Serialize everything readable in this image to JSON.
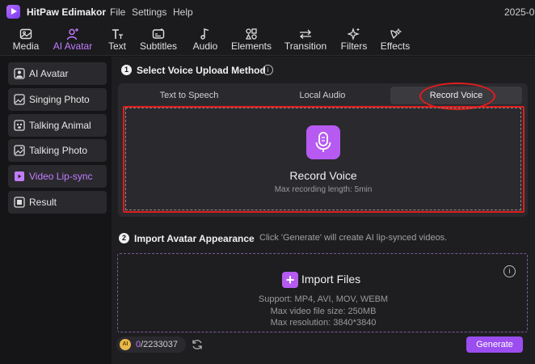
{
  "titlebar": {
    "app_title": "HitPaw Edimakor",
    "menus": [
      "File",
      "Settings",
      "Help"
    ],
    "date_fragment": "2025-0"
  },
  "toolbar": {
    "tools": [
      {
        "label": "Media",
        "icon": "image-icon"
      },
      {
        "label": "AI Avatar",
        "icon": "person-sparkle-icon",
        "active": true
      },
      {
        "label": "Text",
        "icon": "text-icon"
      },
      {
        "label": "Subtitles",
        "icon": "subtitles-icon"
      },
      {
        "label": "Audio",
        "icon": "music-note-icon"
      },
      {
        "label": "Elements",
        "icon": "shapes-icon"
      },
      {
        "label": "Transition",
        "icon": "arrows-icon"
      },
      {
        "label": "Filters",
        "icon": "sparkles-icon"
      },
      {
        "label": "Effects",
        "icon": "wand-icon"
      }
    ]
  },
  "sidebar": {
    "items": [
      {
        "label": "AI Avatar",
        "icon": "avatar-icon"
      },
      {
        "label": "Singing Photo",
        "icon": "photo-icon"
      },
      {
        "label": "Talking Animal",
        "icon": "animal-icon"
      },
      {
        "label": "Talking Photo",
        "icon": "photo-talk-icon"
      },
      {
        "label": "Video Lip-sync",
        "icon": "video-icon",
        "active": true
      },
      {
        "label": "Result",
        "icon": "folder-icon"
      }
    ]
  },
  "step1": {
    "number": "1",
    "title": "Select Voice Upload Method",
    "info": "i",
    "tabs": [
      "Text to Speech",
      "Local Audio",
      "Record Voice"
    ],
    "selected_tab": "Record Voice",
    "record_title": "Record Voice",
    "record_sub": "Max recording length: 5min"
  },
  "step2": {
    "number": "2",
    "title": "Import Avatar Appearance",
    "note": "Click 'Generate' will create AI lip-synced videos.",
    "import_plus": "+",
    "import_label": "Import Files",
    "info": "i",
    "specs": [
      "Support: MP4, AVI, MOV, WEBM",
      "Max video file size: 250MB",
      "Max resolution: 3840*3840"
    ]
  },
  "bottom": {
    "coin_label": "AI",
    "credits_used": "0",
    "credits_rest": "/2233037",
    "generate_label": "Generate"
  },
  "colors": {
    "accent": "#b65af2",
    "highlight_red": "#e11d1d",
    "background": "#151517"
  }
}
